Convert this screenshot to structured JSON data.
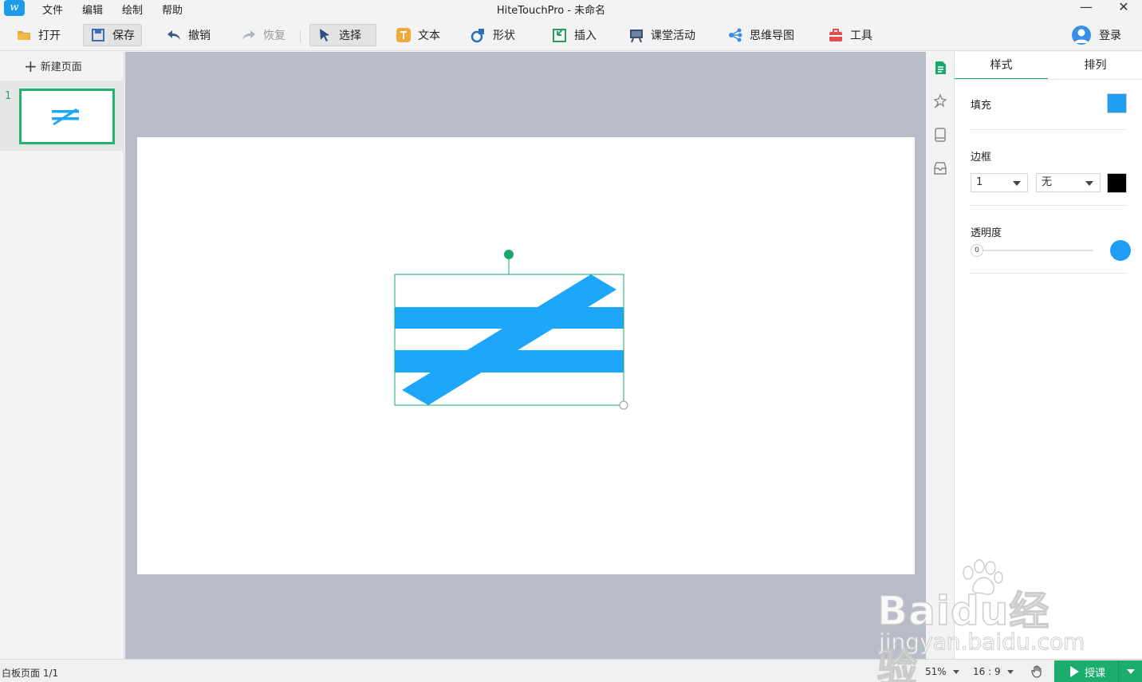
{
  "app": {
    "window_title": "HiteTouchPro - 未命名"
  },
  "menu": [
    "文件",
    "编辑",
    "绘制",
    "帮助"
  ],
  "toolbar": {
    "open": "打开",
    "save": "保存",
    "undo": "撤销",
    "redo": "恢复",
    "select": "选择",
    "text": "文本",
    "shape": "形状",
    "insert": "插入",
    "class_activity": "课堂活动",
    "mind_map": "思维导图",
    "tools": "工具",
    "login": "登录"
  },
  "pages_panel": {
    "new_page": "新建页面",
    "pages": [
      {
        "number": "1"
      }
    ]
  },
  "property_panel": {
    "tabs": [
      "样式",
      "排列"
    ],
    "fill_label": "填充",
    "fill_color": "#1e9ef5",
    "border_label": "边框",
    "border_width": "1",
    "border_style": "无",
    "border_color": "#000000",
    "opacity_label": "透明度",
    "opacity_value": "0"
  },
  "canvas": {
    "shape": "not-equal-sign",
    "shape_color": "#1ea7fa",
    "selection_color": "#1aa86e"
  },
  "status": {
    "page": "白板页面 1/1",
    "zoom": "51%",
    "ratio": "16 : 9",
    "teach": "授课"
  },
  "watermark": {
    "brand": "Baidu经验",
    "url": "jingyan.baidu.com"
  }
}
